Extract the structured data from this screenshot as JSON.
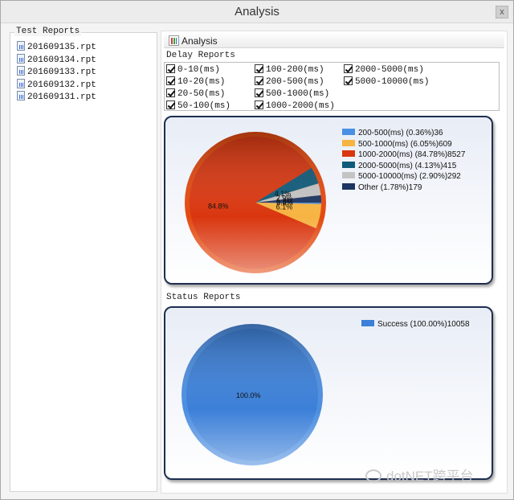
{
  "window": {
    "title": "Analysis",
    "close_label": "x"
  },
  "test_reports": {
    "label": "Test Reports",
    "files": [
      "201609135.rpt",
      "201609134.rpt",
      "201609133.rpt",
      "201609132.rpt",
      "201609131.rpt"
    ]
  },
  "tab": {
    "label": "Analysis"
  },
  "delay_reports": {
    "label": "Delay Reports",
    "options": [
      {
        "label": "0-10(ms)",
        "checked": true
      },
      {
        "label": "10-20(ms)",
        "checked": true
      },
      {
        "label": "20-50(ms)",
        "checked": true
      },
      {
        "label": "50-100(ms)",
        "checked": true
      },
      {
        "label": "100-200(ms)",
        "checked": true
      },
      {
        "label": "200-500(ms)",
        "checked": true
      },
      {
        "label": "500-1000(ms)",
        "checked": true
      },
      {
        "label": "1000-2000(ms)",
        "checked": true
      },
      {
        "label": "2000-5000(ms)",
        "checked": true
      },
      {
        "label": "5000-10000(ms)",
        "checked": true
      }
    ]
  },
  "status_reports": {
    "label": "Status Reports"
  },
  "watermark": "dotNET跨平台",
  "chart_data": [
    {
      "type": "pie",
      "slices": [
        {
          "label": "200-500(ms) (0.36%)36",
          "value": 36,
          "percent": 0.36,
          "color": "#4a90e2",
          "slice_label": "0.4%"
        },
        {
          "label": "500-1000(ms) (6.05%)609",
          "value": 609,
          "percent": 6.05,
          "color": "#f6b443",
          "slice_label": "6.1%"
        },
        {
          "label": "1000-2000(ms) (84.78%)8527",
          "value": 8527,
          "percent": 84.78,
          "color": "#d9360f",
          "slice_label": "84.8%"
        },
        {
          "label": "2000-5000(ms) (4.13%)415",
          "value": 415,
          "percent": 4.13,
          "color": "#0e5a7a",
          "slice_label": "4.1%"
        },
        {
          "label": "5000-10000(ms) (2.90%)292",
          "value": 292,
          "percent": 2.9,
          "color": "#c4c4c4",
          "slice_label": "2.9%"
        },
        {
          "label": "Other (1.78%)179",
          "value": 179,
          "percent": 1.78,
          "color": "#1c3562",
          "slice_label": "1.8%"
        }
      ],
      "legend_position": "top-right"
    },
    {
      "type": "pie",
      "slices": [
        {
          "label": "Success (100.00%)10058",
          "value": 10058,
          "percent": 100.0,
          "color": "#3b7fd8",
          "slice_label": "100.0%"
        }
      ],
      "legend_position": "top-right"
    }
  ]
}
